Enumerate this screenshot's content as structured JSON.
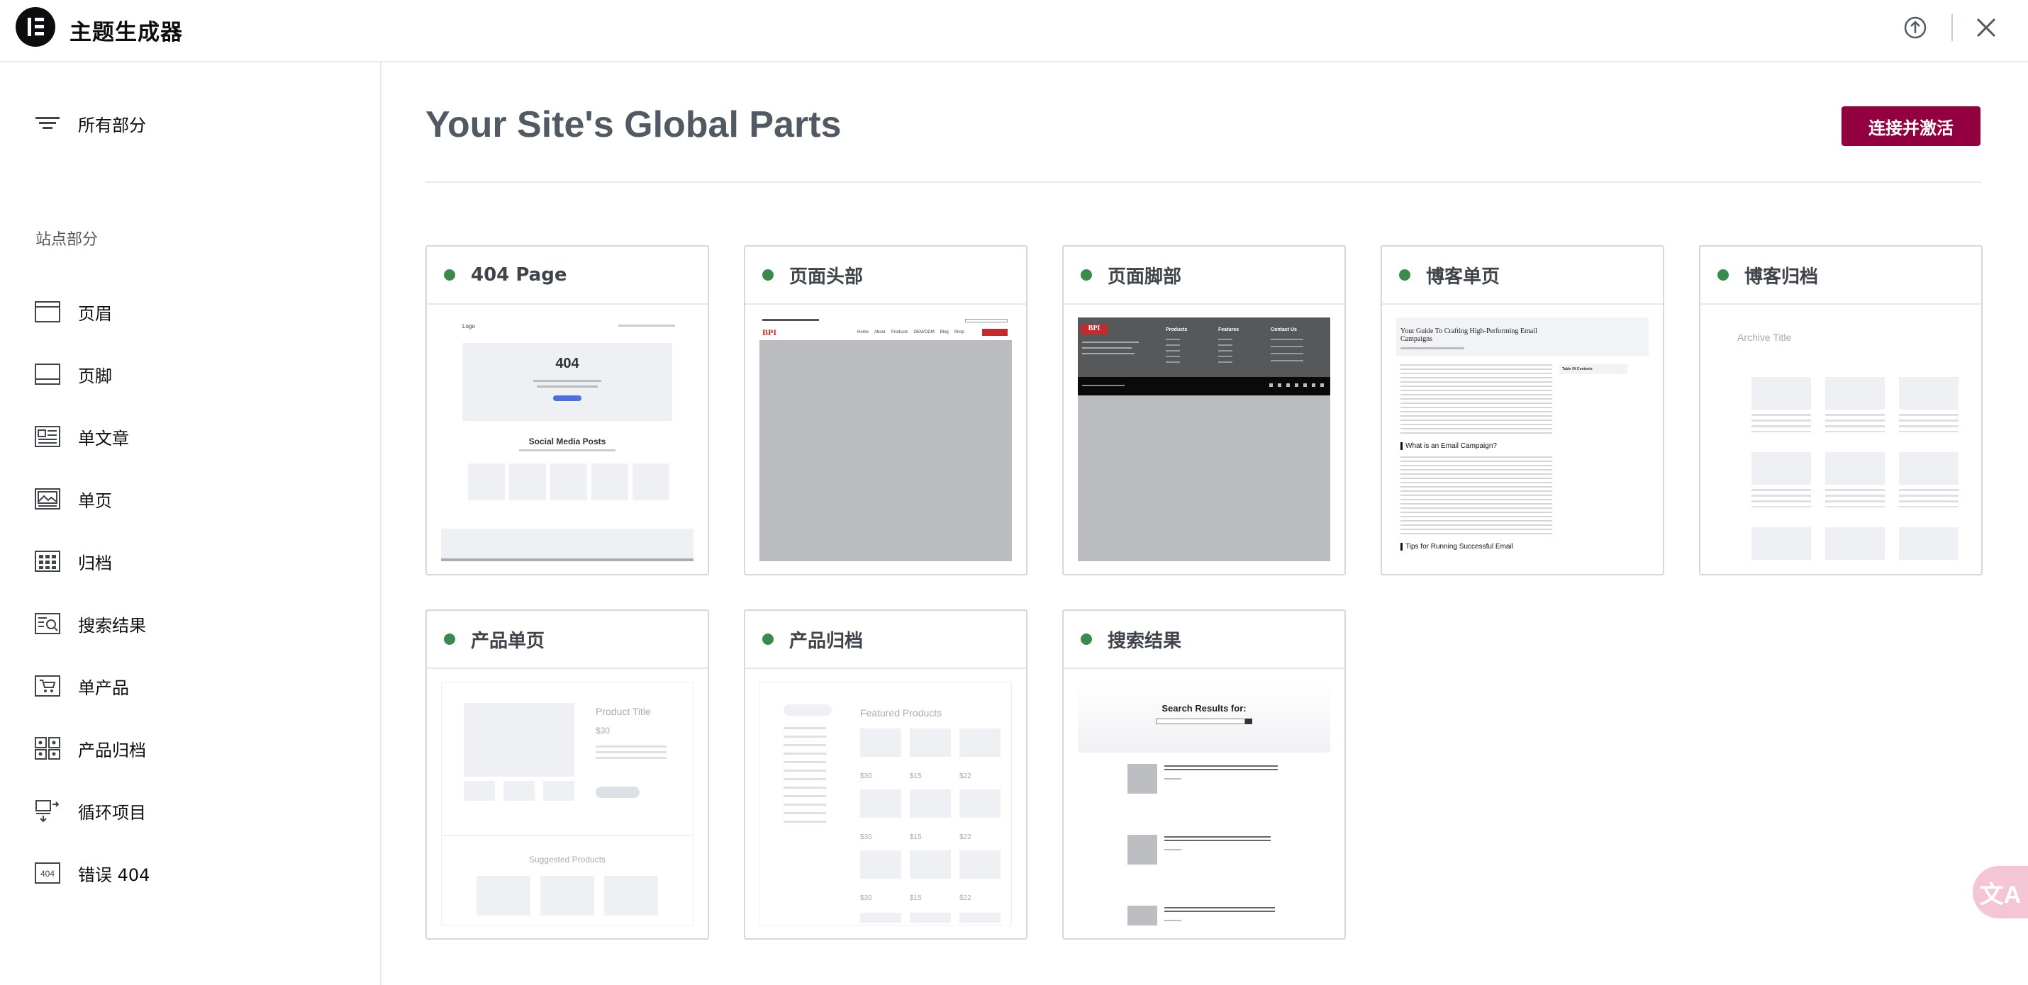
{
  "app": {
    "title": "主题生成器"
  },
  "sidebar": {
    "all_parts": "所有部分",
    "section_label": "站点部分",
    "items": [
      {
        "label": "页眉",
        "icon": "header-icon"
      },
      {
        "label": "页脚",
        "icon": "footer-icon"
      },
      {
        "label": "单文章",
        "icon": "single-post-icon"
      },
      {
        "label": "单页",
        "icon": "single-page-icon"
      },
      {
        "label": "归档",
        "icon": "archive-icon"
      },
      {
        "label": "搜索结果",
        "icon": "search-results-icon"
      },
      {
        "label": "单产品",
        "icon": "single-product-icon"
      },
      {
        "label": "产品归档",
        "icon": "product-archive-icon"
      },
      {
        "label": "循环项目",
        "icon": "loop-item-icon"
      },
      {
        "label": "错误 404",
        "icon": "error-404-icon"
      }
    ]
  },
  "main": {
    "title": "Your Site's Global Parts",
    "connect_button": "连接并激活",
    "cards": [
      {
        "title": "404 Page"
      },
      {
        "title": "页面头部"
      },
      {
        "title": "页面脚部"
      },
      {
        "title": "博客单页"
      },
      {
        "title": "博客归档"
      },
      {
        "title": "产品单页"
      },
      {
        "title": "产品归档"
      },
      {
        "title": "搜索结果"
      }
    ]
  },
  "previews": {
    "p404": {
      "logo": "Logo",
      "code": "404",
      "heading": "Social Media Posts"
    },
    "header": {
      "brand": "BPI",
      "nav": [
        "Home",
        "About",
        "Products",
        "OEM/ODM",
        "Blog",
        "Shop"
      ]
    },
    "footer": {
      "brand": "BPI",
      "col1": "Products",
      "col2": "Features",
      "col3": "Contact Us"
    },
    "blog_single": {
      "title": "Your Guide To Crafting High-Performing Email Campaigns",
      "toc": "Table Of Contents",
      "h1": "What is an Email Campaign?",
      "h2": "Tips for Running Successful Email"
    },
    "blog_archive": {
      "title": "Archive Title"
    },
    "product_single": {
      "title": "Product Title",
      "price": "$30",
      "suggested": "Suggested Products"
    },
    "product_archive": {
      "title": "Featured Products",
      "prices": [
        "$30",
        "$15",
        "$22",
        "$30",
        "$15",
        "$22",
        "$30",
        "$15",
        "$22"
      ]
    },
    "search": {
      "title": "Search Results for:"
    }
  }
}
